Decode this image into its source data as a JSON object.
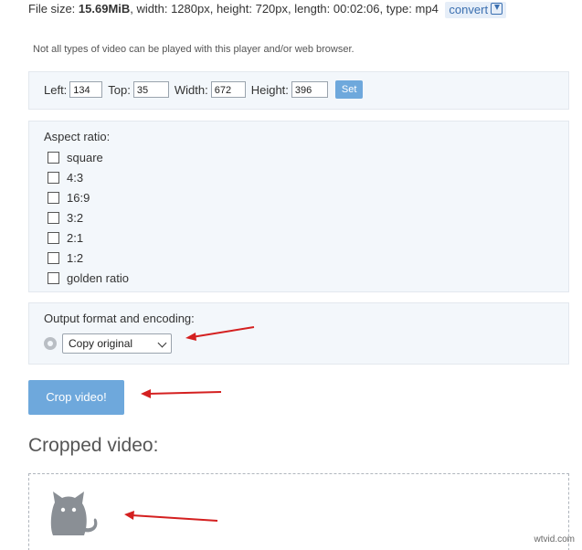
{
  "file_info": {
    "prefix": "File size: ",
    "size": "15.69MiB",
    "rest": ", width: 1280px, height: 720px, length: 00:02:06, type: mp4",
    "convert_label": "convert"
  },
  "note": "Not all types of video can be played with this player and/or web browser.",
  "position": {
    "left_label": "Left:",
    "left_value": "134",
    "top_label": "Top:",
    "top_value": "35",
    "width_label": "Width:",
    "width_value": "672",
    "height_label": "Height:",
    "height_value": "396",
    "set_label": "Set"
  },
  "aspect": {
    "title": "Aspect ratio:",
    "options": [
      "square",
      "4:3",
      "16:9",
      "3:2",
      "2:1",
      "1:2",
      "golden ratio"
    ]
  },
  "output": {
    "title": "Output format and encoding:",
    "selected": "Copy original"
  },
  "crop_button": "Crop video!",
  "cropped_title": "Cropped video:",
  "watermark": "wtvid.com",
  "colors": {
    "accent": "#6ea8dc",
    "panel_bg": "#f3f7fb",
    "arrow": "#d42020"
  },
  "icons": [
    "download-icon",
    "gear-icon",
    "chevron-down-icon",
    "cat-icon"
  ]
}
